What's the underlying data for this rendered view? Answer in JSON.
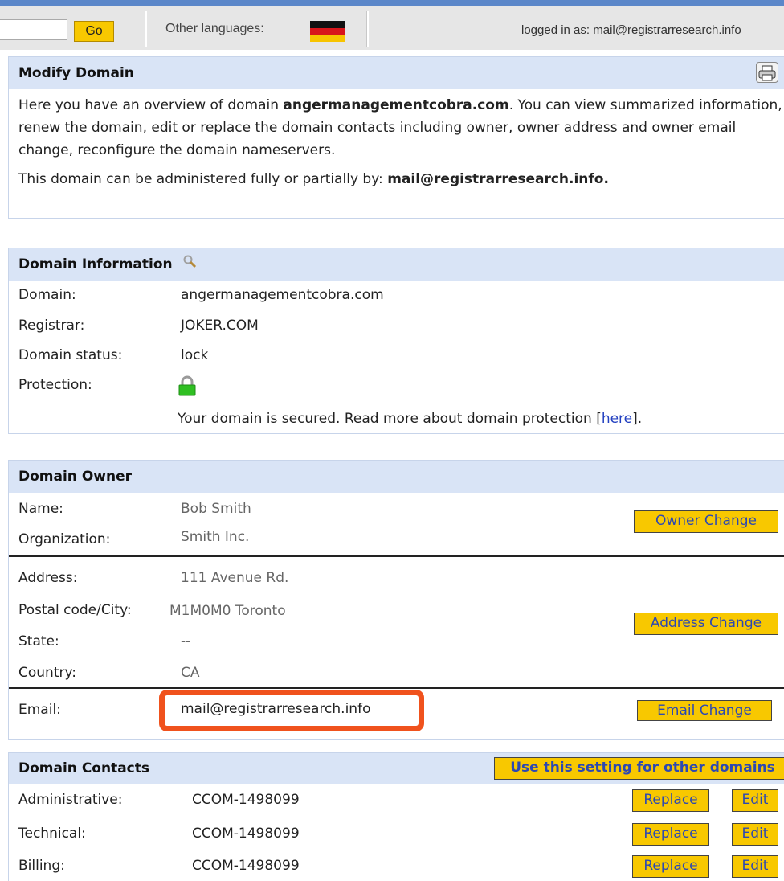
{
  "topbar": {
    "go_label": "Go",
    "other_languages": "Other languages:",
    "logged_in": "logged in as: mail@registrarresearch.info"
  },
  "modify": {
    "title": "Modify Domain",
    "intro_1": "Here you have an overview of domain ",
    "domain_bold": "angermanagementcobra.com",
    "intro_2": ". You can view summarized information, renew the domain, edit or replace the domain contacts including owner, owner address and owner email change, reconfigure the domain nameservers.",
    "admin_prefix": "This domain can be administered fully or partially by: ",
    "admin_email": "mail@registrarresearch.info."
  },
  "domain_info": {
    "title": "Domain Information",
    "rows": [
      {
        "label": "Domain:",
        "value": "angermanagementcobra.com"
      },
      {
        "label": "Registrar:",
        "value": "JOKER.COM"
      },
      {
        "label": "Domain status:",
        "value": "lock"
      },
      {
        "label": "Protection:",
        "value": ""
      }
    ],
    "secured_prefix": "Your domain is secured. Read more about domain protection [",
    "here_link": "here",
    "secured_suffix": "]."
  },
  "owner": {
    "title": "Domain Owner",
    "name_label": "Name:",
    "name_value": "Bob Smith",
    "org_label": "Organization:",
    "org_value": "Smith Inc.",
    "owner_change": "Owner Change",
    "address_label": "Address:",
    "address_value": "111 Avenue Rd.",
    "postal_label": "Postal code/City:",
    "postal_value": "M1M0M0 Toronto",
    "state_label": "State:",
    "state_value": "--",
    "country_label": "Country:",
    "country_value": "CA",
    "address_change": "Address Change",
    "email_label": "Email:",
    "email_value": "mail@registrarresearch.info",
    "email_change": "Email Change"
  },
  "contacts": {
    "title": "Domain Contacts",
    "use_setting": "Use this setting for other domains",
    "replace_label": "Replace",
    "edit_label": "Edit",
    "rows": [
      {
        "label": "Administrative:",
        "value": "CCOM-1498099"
      },
      {
        "label": "Technical:",
        "value": "CCOM-1498099"
      },
      {
        "label": "Billing:",
        "value": "CCOM-1498099"
      }
    ]
  },
  "colors": {
    "accent_yellow": "#f8c800",
    "header_blue": "#d9e4f6",
    "highlight_orange": "#f0521d",
    "lock_green": "#2fbf22"
  }
}
